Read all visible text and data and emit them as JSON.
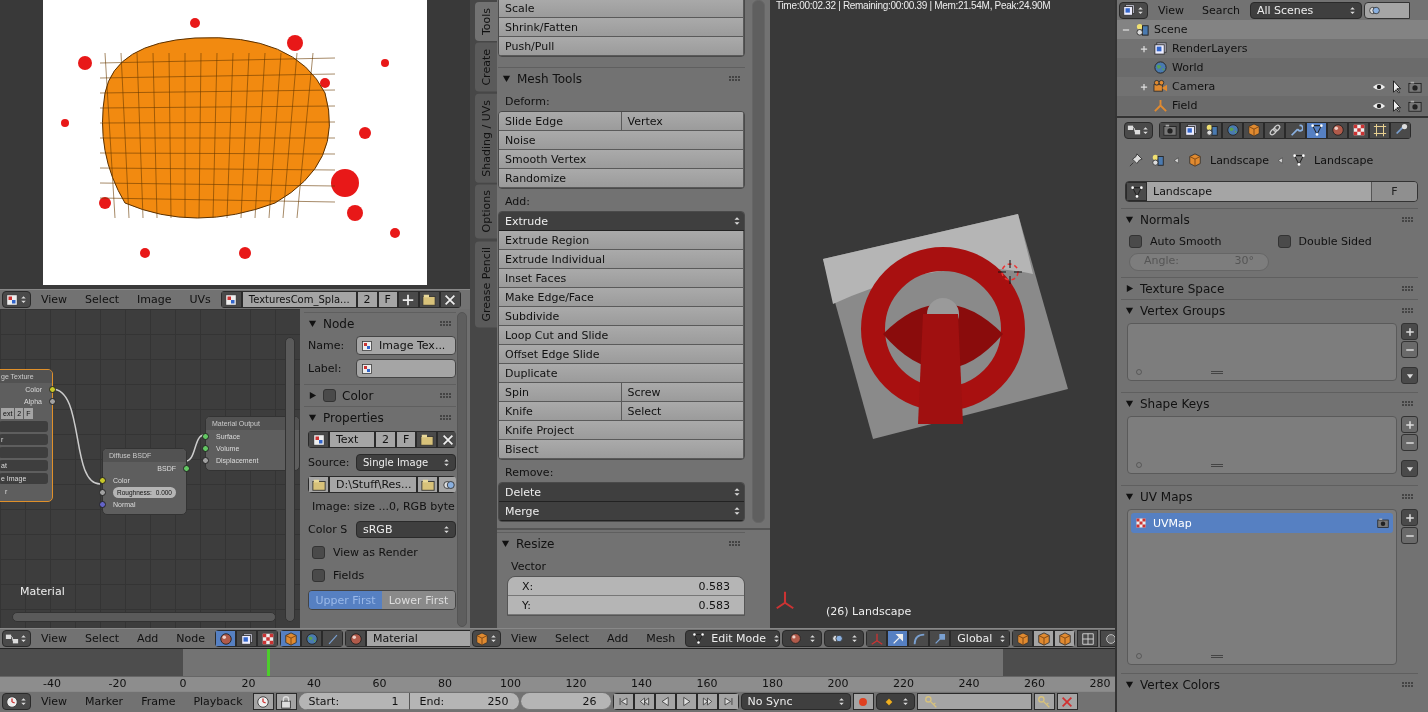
{
  "image_editor": {
    "menus": [
      "View",
      "Select",
      "Image",
      "UVs"
    ],
    "image_name": "TexturesCom_Spla...",
    "users": "2",
    "fake_user": "F"
  },
  "node_editor": {
    "image_node": {
      "title": "ge Texture",
      "outputs": [
        {
          "label": "Color",
          "color": "#c7c729"
        },
        {
          "label": "Alpha",
          "color": "#a1a1a1"
        }
      ],
      "image_name": "ext",
      "users": "2",
      "fake_user": "F",
      "rows": [
        {
          "kind": "blank"
        },
        {
          "kind": "select",
          "text": "r"
        },
        {
          "kind": "blank"
        },
        {
          "kind": "select",
          "text": "at"
        },
        {
          "kind": "select",
          "text": "e Image"
        },
        {
          "kind": "label",
          "text": "r"
        }
      ]
    },
    "diffuse_node": {
      "title": "Diffuse BSDF",
      "output": {
        "label": "BSDF",
        "color": "#63c763"
      },
      "inputs": [
        {
          "kind": "socket",
          "label": "Color",
          "color": "#c7c729"
        },
        {
          "kind": "field",
          "label": "Roughness:",
          "value": "0.000",
          "color": "#a1a1a1"
        },
        {
          "kind": "socket",
          "label": "Normal",
          "color": "#6363c7"
        }
      ]
    },
    "output_node": {
      "title": "Material Output",
      "inputs": [
        {
          "label": "Surface",
          "color": "#63c763"
        },
        {
          "label": "Volume",
          "color": "#63c763"
        },
        {
          "label": "Displacement",
          "color": "#a1a1a1"
        }
      ]
    },
    "tree_label": "Material"
  },
  "node_sidebar": {
    "node_panel": {
      "title": "Node",
      "expanded": true,
      "name_label": "Name:",
      "name_value": "Image Tex...",
      "label_label": "Label:"
    },
    "color_panel": {
      "title": "Color",
      "expanded": false,
      "checked": false
    },
    "properties_panel": {
      "title": "Properties",
      "expanded": true,
      "image_name": "Text",
      "users": "2",
      "fake_user": "F",
      "source_label": "Source:",
      "source_value": "Single Image",
      "path": "D:\\Stuff\\Res...",
      "image_info": "Image: size ...0, RGB byte",
      "colorspace_label": "Color S",
      "colorspace_value": "sRGB",
      "checkboxes": [
        {
          "label": "View as Render",
          "checked": false
        },
        {
          "label": "Fields",
          "checked": false
        }
      ],
      "field_order": [
        {
          "label": "Upper First",
          "selected": true
        },
        {
          "label": "Lower First",
          "selected": false
        }
      ]
    }
  },
  "node_header": {
    "menus": [
      "View",
      "Select",
      "Add",
      "Node"
    ],
    "tree_types": [
      {
        "kind": "sphere",
        "selected": true
      },
      {
        "kind": "layers",
        "selected": false
      },
      {
        "kind": "checker",
        "selected": false
      }
    ],
    "shader_sources": [
      {
        "kind": "cube",
        "selected": true
      },
      {
        "kind": "globe",
        "selected": false
      },
      {
        "kind": "brush",
        "selected": false
      }
    ],
    "material": "Material"
  },
  "tool_shelf": {
    "tabs": [
      {
        "label": "Tools",
        "selected": true
      },
      {
        "label": "Create",
        "selected": false
      },
      {
        "label": "Shading / UVs",
        "selected": false
      },
      {
        "label": "Options",
        "selected": false
      },
      {
        "label": "Grease Pencil",
        "selected": false
      }
    ],
    "transform_buttons": [
      "Scale",
      "Shrink/Fatten",
      "Push/Pull"
    ],
    "mesh_tools": {
      "title": "Mesh Tools",
      "expanded": true,
      "groups": [
        {
          "label": "Deform:",
          "rows": [
            {
              "kind": "buttons",
              "items": [
                "Slide Edge",
                "Vertex"
              ]
            },
            {
              "kind": "buttons",
              "items": [
                "Noise"
              ]
            },
            {
              "kind": "buttons",
              "items": [
                "Smooth Vertex"
              ]
            },
            {
              "kind": "buttons",
              "items": [
                "Randomize"
              ]
            }
          ]
        },
        {
          "label": "Add:",
          "rows": [
            {
              "kind": "menu",
              "items": [
                "Extrude"
              ]
            },
            {
              "kind": "buttons",
              "items": [
                "Extrude Region"
              ]
            },
            {
              "kind": "buttons",
              "items": [
                "Extrude Individual"
              ]
            },
            {
              "kind": "buttons",
              "items": [
                "Inset Faces"
              ]
            },
            {
              "kind": "buttons",
              "items": [
                "Make Edge/Face"
              ]
            },
            {
              "kind": "buttons",
              "items": [
                "Subdivide"
              ]
            },
            {
              "kind": "buttons",
              "items": [
                "Loop Cut and Slide"
              ]
            },
            {
              "kind": "buttons",
              "items": [
                "Offset Edge Slide"
              ]
            },
            {
              "kind": "buttons",
              "items": [
                "Duplicate"
              ]
            },
            {
              "kind": "buttons",
              "items": [
                "Spin",
                "Screw"
              ]
            },
            {
              "kind": "buttons",
              "items": [
                "Knife",
                "Select"
              ]
            },
            {
              "kind": "buttons",
              "items": [
                "Knife Project"
              ]
            },
            {
              "kind": "buttons",
              "items": [
                "Bisect"
              ]
            }
          ]
        },
        {
          "label": "Remove:",
          "rows": [
            {
              "kind": "menu",
              "items": [
                "Delete"
              ]
            },
            {
              "kind": "menu",
              "items": [
                "Merge"
              ]
            }
          ]
        }
      ]
    },
    "resize": {
      "title": "Resize",
      "expanded": true,
      "label": "Vector",
      "fields": [
        {
          "label": "X:",
          "value": "0.583"
        },
        {
          "label": "Y:",
          "value": "0.583"
        }
      ]
    }
  },
  "viewport": {
    "info": "Time:00:02.32 | Remaining:00:00.39 | Mem:21.54M, Peak:24.90M",
    "object_label": "(26) Landscape"
  },
  "view3d_header": {
    "menus": [
      "View",
      "Select",
      "Add",
      "Mesh"
    ],
    "mode": "Edit Mode",
    "manipulators": [
      {
        "kind": "axes",
        "selected": false
      },
      {
        "kind": "arrow",
        "selected": true
      },
      {
        "kind": "arc",
        "selected": false
      },
      {
        "kind": "scale",
        "selected": false
      }
    ],
    "orientation": "Global",
    "select_modes": [
      {
        "selected": false
      },
      {
        "selected": true
      },
      {
        "selected": true
      }
    ]
  },
  "timeline": {
    "ticks": [
      "-40",
      "-20",
      "0",
      "20",
      "40",
      "60",
      "80",
      "100",
      "120",
      "140",
      "160",
      "180",
      "200",
      "220",
      "240",
      "260",
      "280"
    ],
    "menus": [
      "View",
      "Marker",
      "Frame",
      "Playback"
    ],
    "start_label": "Start:",
    "start": "1",
    "end_label": "End:",
    "end": "250",
    "frame": "26",
    "sync": "No Sync"
  },
  "outliner": {
    "menus": [
      "View",
      "Search"
    ],
    "filter": "All Scenes",
    "tree": [
      {
        "label": "Scene",
        "kind": "scene",
        "selected": true,
        "expanded": true,
        "children": [
          {
            "label": "RenderLayers",
            "kind": "layers",
            "selected": false,
            "expanded": false
          },
          {
            "label": "World",
            "kind": "globe",
            "selected": false
          },
          {
            "label": "Camera",
            "kind": "camera",
            "selected": false,
            "expanded": false,
            "restrict": true
          },
          {
            "label": "Field",
            "kind": "field",
            "selected": false,
            "restrict": true
          }
        ]
      }
    ]
  },
  "properties": {
    "tabs": [
      {
        "kind": "render",
        "selected": false
      },
      {
        "kind": "layers",
        "selected": false
      },
      {
        "kind": "scene",
        "selected": false
      },
      {
        "kind": "globe",
        "selected": false
      },
      {
        "kind": "cube",
        "selected": false
      },
      {
        "kind": "link",
        "selected": false
      },
      {
        "kind": "wrench",
        "selected": false
      },
      {
        "kind": "mesh",
        "selected": true
      },
      {
        "kind": "sphere",
        "selected": false
      },
      {
        "kind": "checker",
        "selected": false
      },
      {
        "kind": "sparkle",
        "selected": false
      },
      {
        "kind": "physics",
        "selected": false
      }
    ],
    "breadcrumb": [
      "Landscape",
      "Landscape"
    ],
    "datablock": "Landscape",
    "fake_user": "F",
    "panels": [
      {
        "kind": "normals",
        "title": "Normals",
        "expanded": true,
        "checkboxes": [
          {
            "label": "Auto Smooth",
            "checked": false
          },
          {
            "label": "Double Sided",
            "checked": false
          }
        ],
        "angle_label": "Angle:",
        "angle_value": "30°",
        "angle_disabled": true
      },
      {
        "kind": "plain",
        "title": "Texture Space",
        "expanded": false
      },
      {
        "kind": "list",
        "title": "Vertex Groups",
        "expanded": true
      },
      {
        "kind": "list",
        "title": "Shape Keys",
        "expanded": true
      },
      {
        "kind": "list",
        "title": "UV Maps",
        "expanded": true,
        "items": [
          {
            "label": "UVMap",
            "selected": true
          }
        ]
      },
      {
        "kind": "plain",
        "title": "Vertex Colors",
        "expanded": true
      }
    ]
  }
}
